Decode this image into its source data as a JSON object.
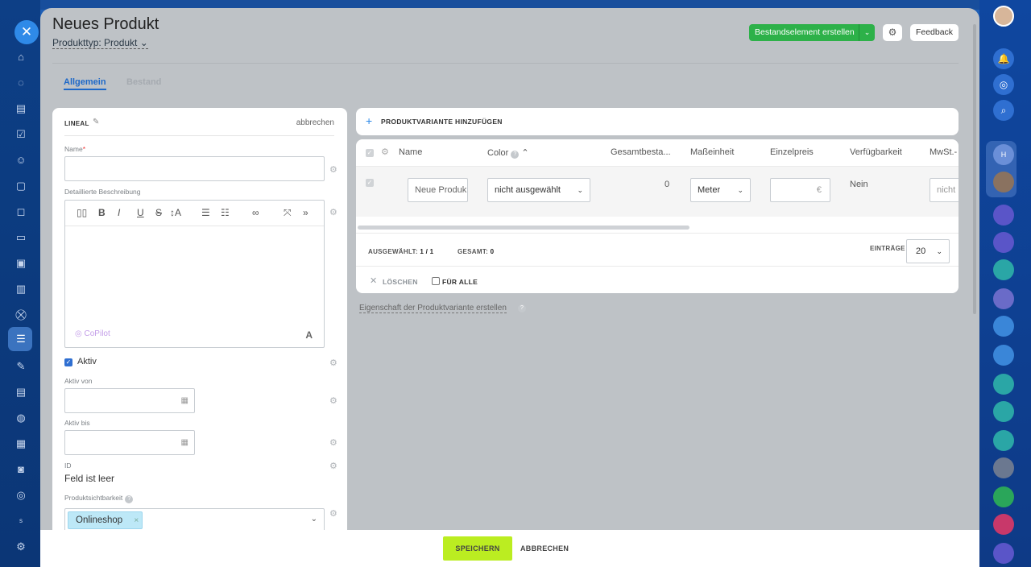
{
  "panel": {
    "title": "Neues Produkt",
    "product_type": "Produkttyp: Produkt",
    "create_stock_button": "Bestandselement erstellen",
    "feedback_button": "Feedback"
  },
  "tabs": [
    {
      "label": "Allgemein",
      "active": true
    },
    {
      "label": "Bestand",
      "active": false
    }
  ],
  "left_card": {
    "section": "LINEAL",
    "cancel_link": "abbrechen",
    "name_label": "Name",
    "name_required": "*",
    "description_label": "Detaillierte Beschreibung",
    "copilot_label": "CoPilot",
    "active_label": "Aktiv",
    "active_checked": true,
    "active_from_label": "Aktiv von",
    "active_until_label": "Aktiv bis",
    "id_label": "ID",
    "id_value": "Feld ist leer",
    "visibility_label": "Produktsichtbarkeit",
    "visibility_tag": "Onlineshop"
  },
  "variants": {
    "add_button": "PRODUKTVARIANTE HINZUFÜGEN",
    "columns": [
      "Name",
      "Color",
      "Gesamtbesta...",
      "Maßeinheit",
      "Einzelpreis",
      "Verfügbarkeit",
      "MwSt.-"
    ],
    "row": {
      "name": "Neue Produk",
      "color": "nicht ausgewählt",
      "total_stock": "0",
      "unit": "Meter",
      "price_currency": "€",
      "availability": "Nein",
      "vat": "nicht"
    },
    "selected_label": "AUSGEWÄHLT:",
    "selected_value": "1 / 1",
    "total_label": "GESAMT:",
    "total_value": "0",
    "entries_label": "EINTRÄGE",
    "entries_value": "20",
    "delete_label": "LÖSCHEN",
    "for_all_label": "FÜR ALLE",
    "property_link": "Eigenschaft der Produktvariante erstellen"
  },
  "footer": {
    "save": "SPEICHERN",
    "cancel": "ABBRECHEN"
  },
  "colors": {
    "accent": "#2f6fd1",
    "save_button": "#bbed21",
    "create_button": "#2db149"
  }
}
